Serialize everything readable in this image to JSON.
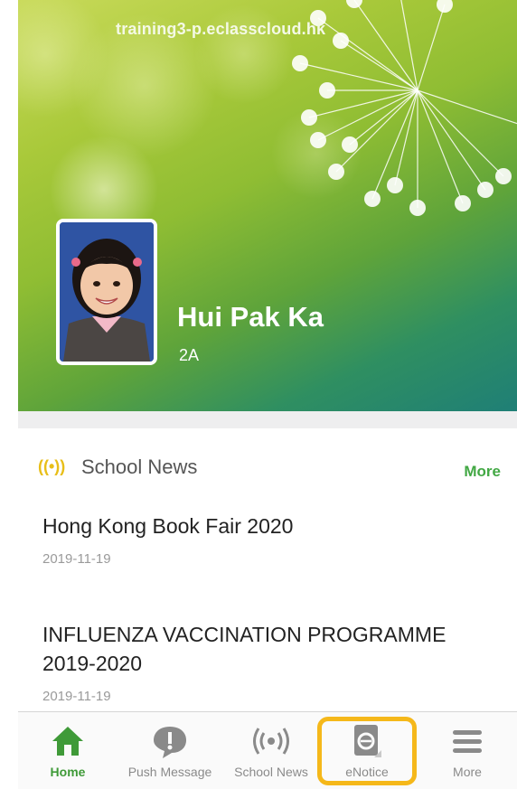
{
  "header": {
    "url": "training3-p.eclasscloud.hk",
    "student_name": "Hui Pak Ka",
    "student_class": "2A"
  },
  "news": {
    "section_title": "School News",
    "more_label": "More",
    "items": [
      {
        "title": "Hong Kong Book Fair 2020",
        "date": "2019-11-19"
      },
      {
        "title": "INFLUENZA VACCINATION PROGRAMME 2019-2020",
        "date": "2019-11-19"
      }
    ]
  },
  "tabbar": {
    "tabs": [
      {
        "label": "Home",
        "icon": "home-icon",
        "active": true
      },
      {
        "label": "Push Message",
        "icon": "message-bubble-icon",
        "active": false
      },
      {
        "label": "School News",
        "icon": "broadcast-icon",
        "active": false
      },
      {
        "label": "eNotice",
        "icon": "notice-book-icon",
        "active": false,
        "highlighted": true
      },
      {
        "label": "More",
        "icon": "menu-icon",
        "active": false
      }
    ]
  },
  "colors": {
    "accent_green": "#42a844",
    "highlight_orange": "#f5b81a",
    "news_icon_yellow": "#e8be18"
  }
}
